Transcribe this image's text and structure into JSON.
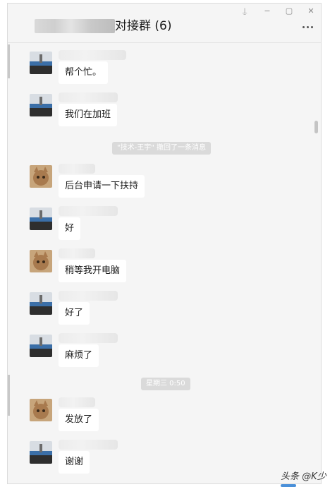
{
  "window": {
    "title": "对接群 (6)",
    "controls": {
      "pin": "⍊",
      "minimize": "−",
      "maximize": "▢",
      "close": "✕"
    }
  },
  "messages": [
    {
      "avatar": "road-scene-avatar",
      "text": "帮个忙。"
    },
    {
      "avatar": "road-scene-avatar",
      "text": "我们在加班"
    },
    {
      "avatar": "cat-avatar",
      "text": "后台申请一下扶持"
    },
    {
      "avatar": "road-scene-avatar",
      "text": "好"
    },
    {
      "avatar": "cat-avatar",
      "text": "稍等我开电脑"
    },
    {
      "avatar": "road-scene-avatar",
      "text": "好了"
    },
    {
      "avatar": "road-scene-avatar",
      "text": "麻烦了"
    },
    {
      "avatar": "cat-avatar",
      "text": "发放了"
    },
    {
      "avatar": "road-scene-avatar",
      "text": "谢谢"
    }
  ],
  "system_notices": {
    "recall": "\"技术-王宇\" 撤回了一条消息",
    "timestamp": "星期三 0:50"
  },
  "watermark": "头条 @K少",
  "colors": {
    "background": "#f5f5f5",
    "bubble": "#ffffff",
    "system_pill": "#dadada"
  }
}
